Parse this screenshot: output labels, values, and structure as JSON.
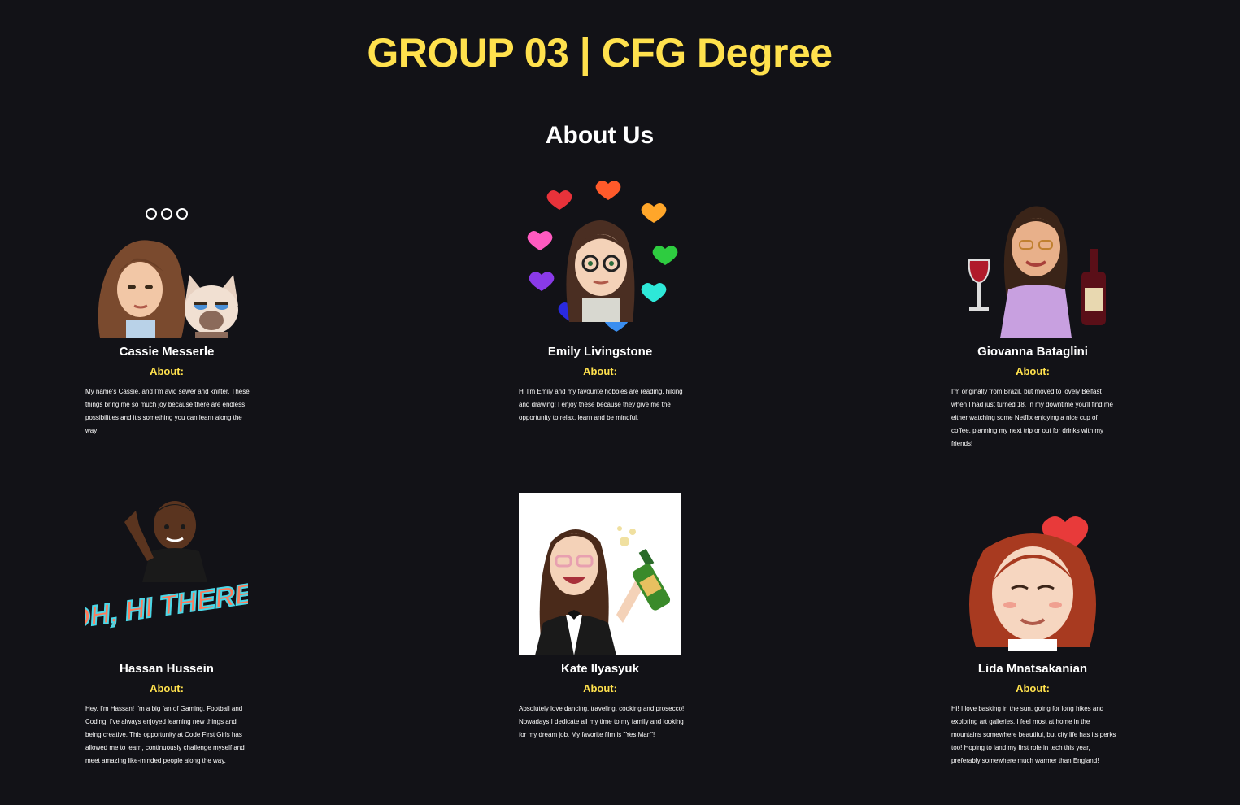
{
  "header": {
    "title": "GROUP 03 | CFG Degree"
  },
  "about": {
    "heading": "About Us",
    "label": "About:",
    "members": [
      {
        "name": "Cassie Messerle",
        "bio": "My name's Cassie, and I'm avid sewer and knitter. These things bring me so much joy because there are endless possibilities and it's something you can learn along the way!"
      },
      {
        "name": "Emily Livingstone",
        "bio": "Hi I'm Emily and my favourite hobbies are reading, hiking and drawing! I enjoy these because they give me the opportunity to relax, learn and be mindful."
      },
      {
        "name": "Giovanna Bataglini",
        "bio": "I'm originally from Brazil, but moved to lovely Belfast when I had just turned 18. In my downtime you'll find me either watching some Netflix enjoying a nice cup of coffee, planning my next trip or out for drinks with my friends!"
      },
      {
        "name": "Hassan Hussein",
        "bio": "Hey, I'm Hassan! I'm a big fan of Gaming, Football and Coding. I've always enjoyed learning new things and being creative. This opportunity at Code First Girls has allowed me to learn, continuously challenge myself and meet amazing like-minded people along the way.",
        "sticker_text": "OH, HI THERE!"
      },
      {
        "name": "Kate Ilyasyuk",
        "bio": "Absolutely love dancing, traveling, cooking and prosecco! Nowadays I dedicate all my time to my family and looking for my dream job. My favorite film is \"Yes Man\"!"
      },
      {
        "name": "Lida Mnatsakanian",
        "bio": "Hi! I love basking in the sun, going for long hikes and exploring art galleries. I feel most at home in the mountains somewhere beautiful, but city life has its perks too! Hoping to land my first role in tech this year, preferably somewhere much warmer than England!"
      }
    ]
  },
  "colors": {
    "background": "#121217",
    "accent": "#ffe14d",
    "text": "#ffffff"
  },
  "icons": [
    "loading-dots-icon",
    "bitmoji-avatar"
  ]
}
